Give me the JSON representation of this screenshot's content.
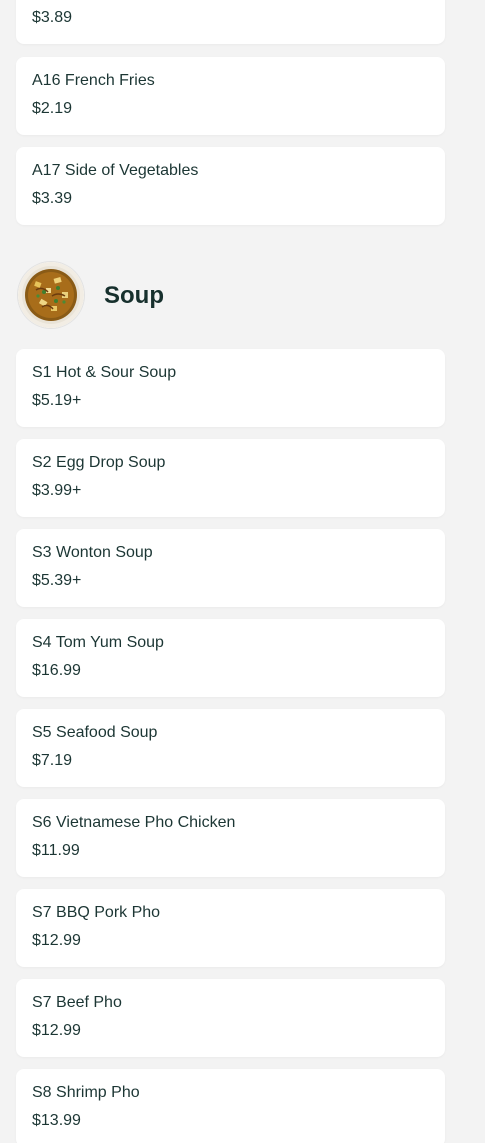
{
  "top_items": [
    {
      "name": "",
      "price": "$3.89"
    },
    {
      "name": "A16 French Fries",
      "price": "$2.19"
    },
    {
      "name": "A17 Side of Vegetables",
      "price": "$3.39"
    }
  ],
  "soup_section": {
    "title": "Soup",
    "image_icon": "soup-bowl-image",
    "items": [
      {
        "name": "S1 Hot & Sour Soup",
        "price": "$5.19+"
      },
      {
        "name": "S2 Egg Drop Soup",
        "price": "$3.99+"
      },
      {
        "name": "S3 Wonton Soup",
        "price": "$5.39+"
      },
      {
        "name": "S4 Tom Yum Soup",
        "price": "$16.99"
      },
      {
        "name": "S5 Seafood Soup",
        "price": "$7.19"
      },
      {
        "name": "S6 Vietnamese Pho Chicken",
        "price": "$11.99"
      },
      {
        "name": "S7 BBQ Pork Pho",
        "price": "$12.99"
      },
      {
        "name": "S7 Beef Pho",
        "price": "$12.99"
      },
      {
        "name": "S8 Shrimp Pho",
        "price": "$13.99"
      }
    ]
  },
  "colors": {
    "background": "#f3f3f3",
    "card": "#ffffff",
    "text": "#1c3634"
  }
}
